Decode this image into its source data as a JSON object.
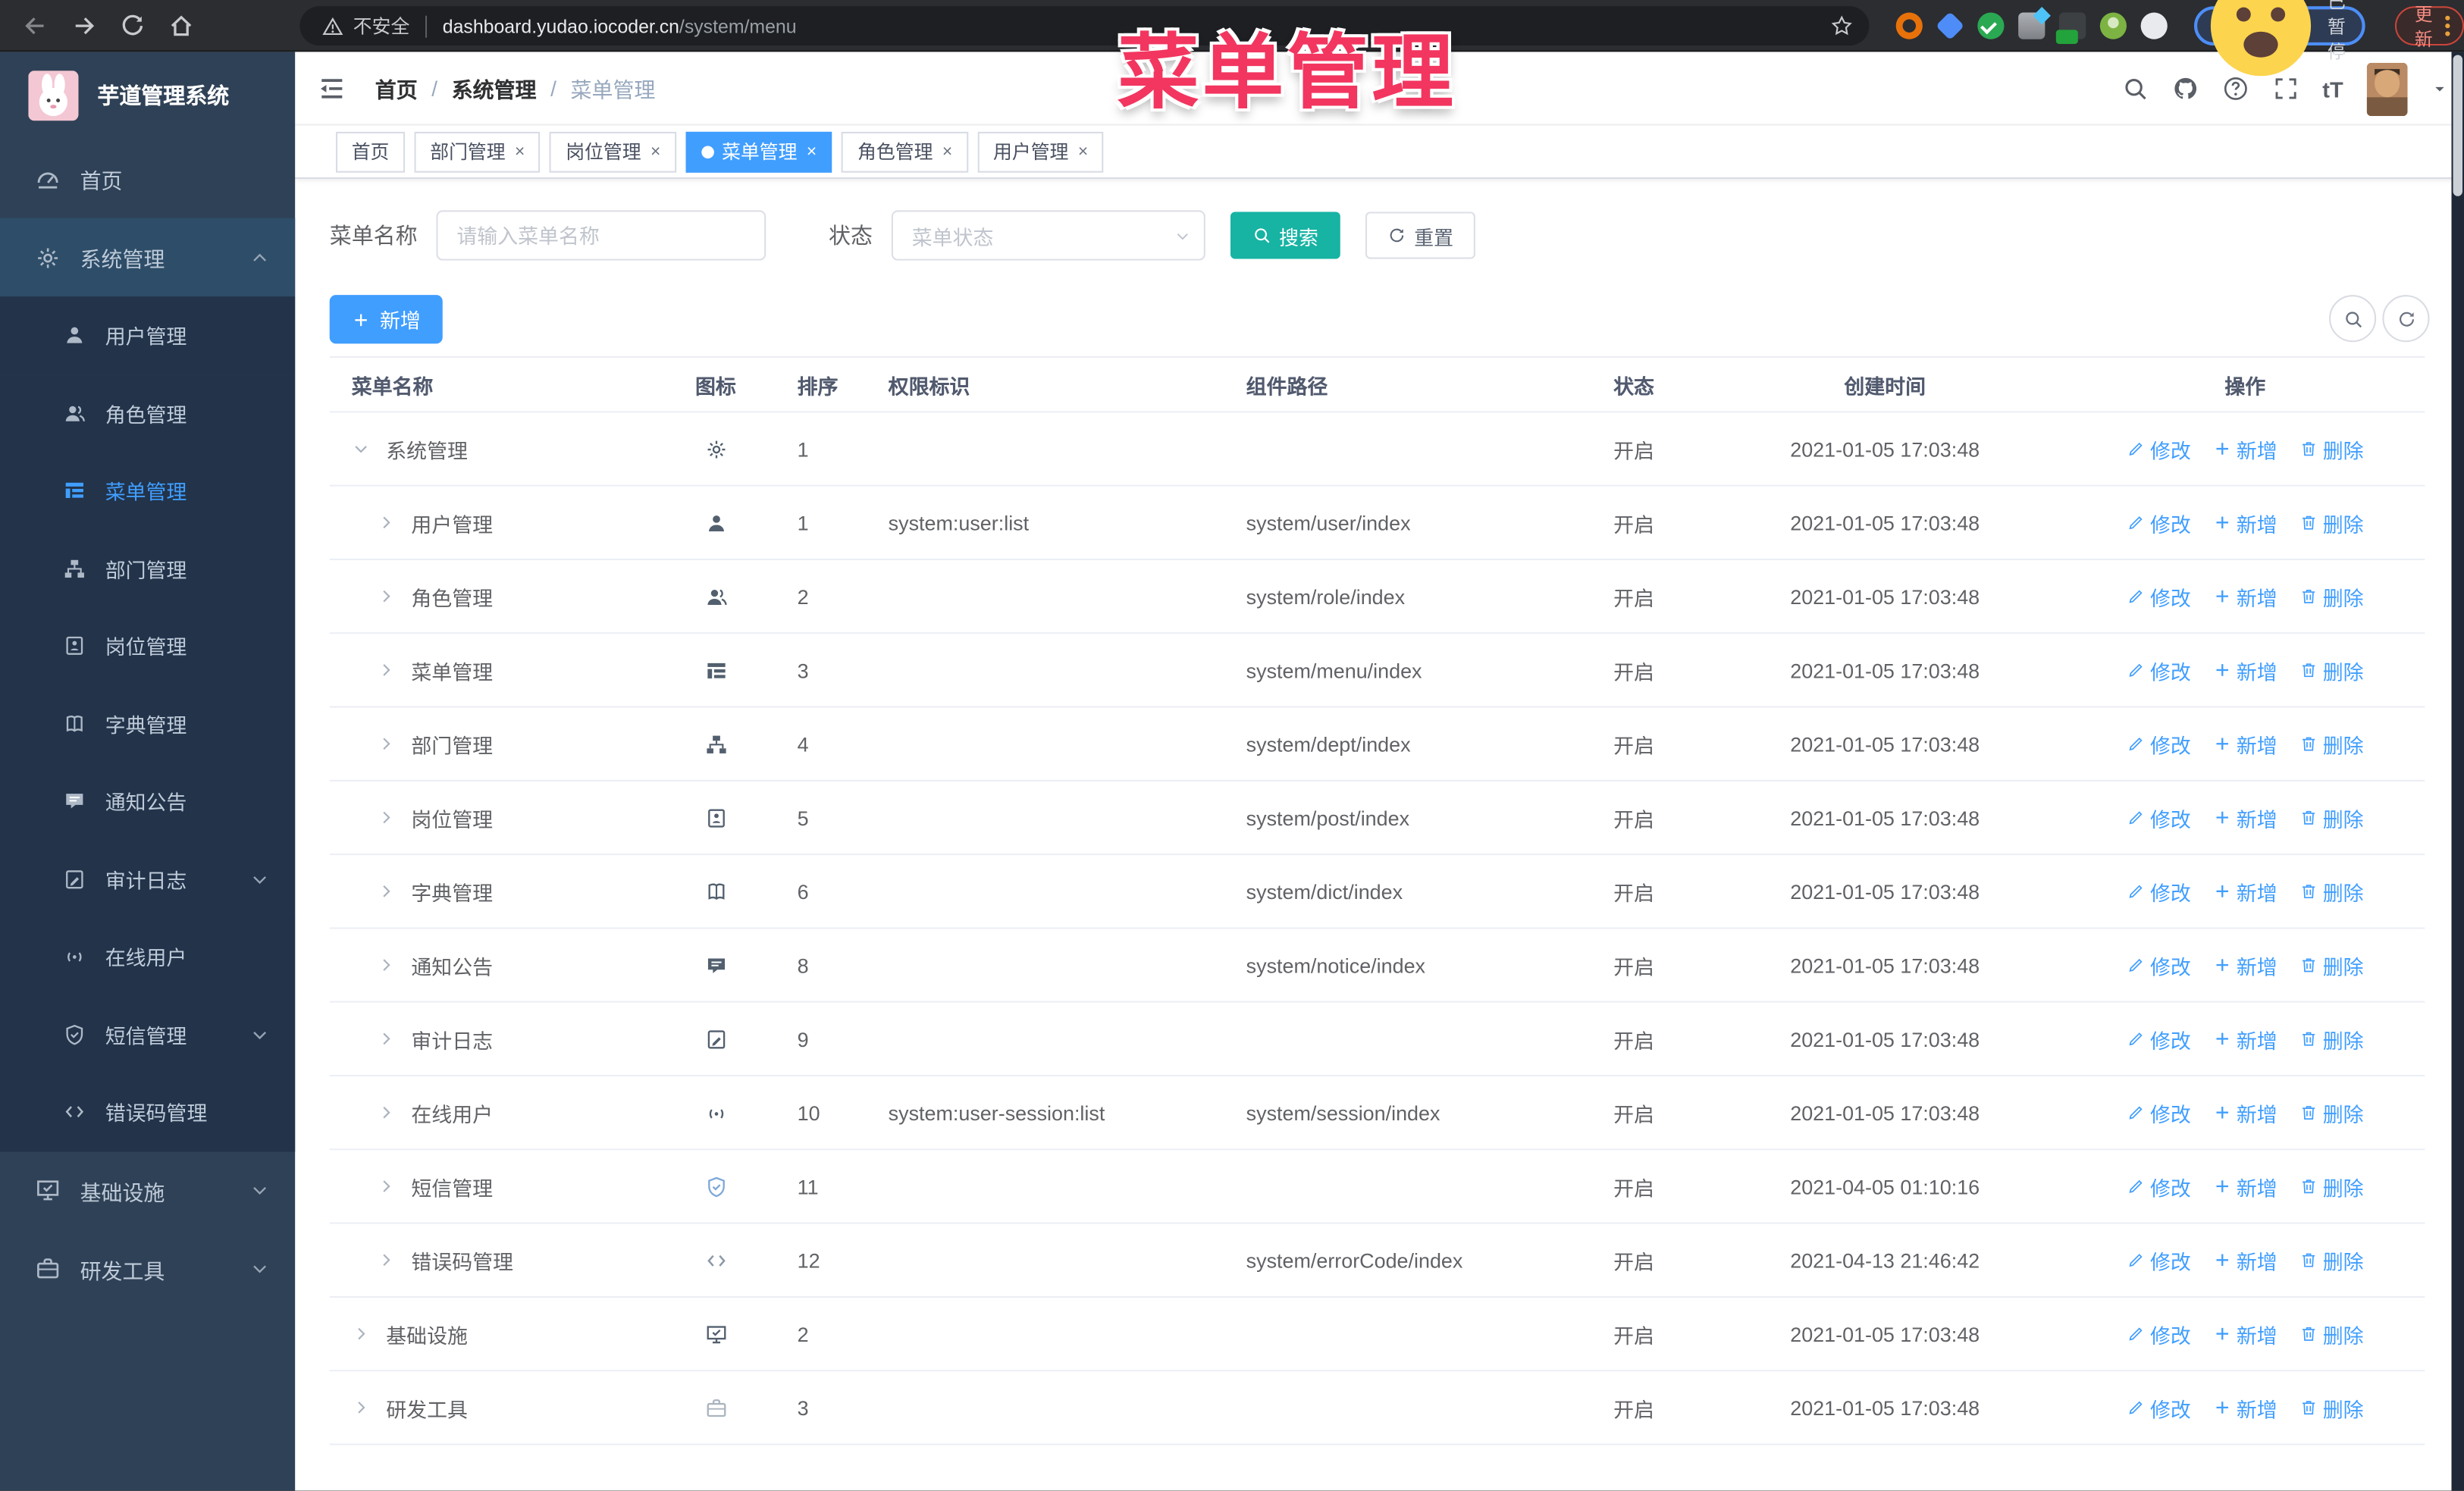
{
  "browser": {
    "security_label": "不安全",
    "url_host": "dashboard.yudao.iocoder.cn",
    "url_path": "/system/menu",
    "nav_icons": [
      "back-icon",
      "forward-icon",
      "reload-icon",
      "home-icon"
    ],
    "extension_icons": [
      "ext-orange-icon",
      "ext-gem-icon",
      "ext-green-check-icon",
      "ext-grid-icon",
      "ext-dark-on-icon",
      "ext-person-icon",
      "ext-puzzle-icon"
    ],
    "profile_badge": "已暂停",
    "update_label": "更新"
  },
  "overlay": {
    "title": "菜单管理"
  },
  "sidebar": {
    "logo_title": "芋道管理系统",
    "menu": [
      {
        "icon": "dashboard",
        "label": "首页",
        "level": 0
      },
      {
        "icon": "gear",
        "label": "系统管理",
        "level": 0,
        "highlight": true,
        "chevron": "up"
      },
      {
        "icon": "user",
        "label": "用户管理",
        "level": 1
      },
      {
        "icon": "users",
        "label": "角色管理",
        "level": 1
      },
      {
        "icon": "tree-table",
        "label": "菜单管理",
        "level": 1,
        "active": true
      },
      {
        "icon": "tree",
        "label": "部门管理",
        "level": 1
      },
      {
        "icon": "post",
        "label": "岗位管理",
        "level": 1
      },
      {
        "icon": "dict",
        "label": "字典管理",
        "level": 1
      },
      {
        "icon": "message",
        "label": "通知公告",
        "level": 1
      },
      {
        "icon": "log",
        "label": "审计日志",
        "level": 1,
        "chevron": "down"
      },
      {
        "icon": "online",
        "label": "在线用户",
        "level": 1
      },
      {
        "icon": "sms",
        "label": "短信管理",
        "level": 1,
        "chevron": "down"
      },
      {
        "icon": "code",
        "label": "错误码管理",
        "level": 1
      },
      {
        "icon": "monitor",
        "label": "基础设施",
        "level": 0,
        "chevron": "down"
      },
      {
        "icon": "tool",
        "label": "研发工具",
        "level": 0,
        "chevron": "down"
      }
    ]
  },
  "header": {
    "breadcrumb": [
      "首页",
      "系统管理",
      "菜单管理"
    ],
    "right_icons": [
      "search-icon",
      "github-icon",
      "help-icon",
      "fullscreen-icon",
      "font-size-icon",
      "avatar",
      "caret-down-icon"
    ],
    "font_size_icon_text": "tT"
  },
  "tabs": [
    {
      "label": "首页",
      "closable": false,
      "active": false
    },
    {
      "label": "部门管理",
      "closable": true,
      "active": false
    },
    {
      "label": "岗位管理",
      "closable": true,
      "active": false
    },
    {
      "label": "菜单管理",
      "closable": true,
      "active": true
    },
    {
      "label": "角色管理",
      "closable": true,
      "active": false
    },
    {
      "label": "用户管理",
      "closable": true,
      "active": false
    }
  ],
  "filters": {
    "name_label": "菜单名称",
    "name_placeholder": "请输入菜单名称",
    "status_label": "状态",
    "status_placeholder": "菜单状态",
    "search_label": "搜索",
    "reset_label": "重置"
  },
  "toolbar": {
    "add_label": "新增"
  },
  "table": {
    "columns": [
      "菜单名称",
      "图标",
      "排序",
      "权限标识",
      "组件路径",
      "状态",
      "创建时间",
      "操作"
    ],
    "row_actions": [
      "修改",
      "新增",
      "删除"
    ],
    "rows": [
      {
        "level": 0,
        "expanded": true,
        "name": "系统管理",
        "icon": "gear",
        "sort": "1",
        "perm": "",
        "path": "",
        "status": "开启",
        "time": "2021-01-05 17:03:48"
      },
      {
        "level": 1,
        "name": "用户管理",
        "icon": "user",
        "sort": "1",
        "perm": "system:user:list",
        "path": "system/user/index",
        "status": "开启",
        "time": "2021-01-05 17:03:48"
      },
      {
        "level": 1,
        "name": "角色管理",
        "icon": "users",
        "sort": "2",
        "perm": "",
        "path": "system/role/index",
        "status": "开启",
        "time": "2021-01-05 17:03:48"
      },
      {
        "level": 1,
        "name": "菜单管理",
        "icon": "tree-table",
        "sort": "3",
        "perm": "",
        "path": "system/menu/index",
        "status": "开启",
        "time": "2021-01-05 17:03:48"
      },
      {
        "level": 1,
        "name": "部门管理",
        "icon": "tree",
        "sort": "4",
        "perm": "",
        "path": "system/dept/index",
        "status": "开启",
        "time": "2021-01-05 17:03:48"
      },
      {
        "level": 1,
        "name": "岗位管理",
        "icon": "post",
        "sort": "5",
        "perm": "",
        "path": "system/post/index",
        "status": "开启",
        "time": "2021-01-05 17:03:48"
      },
      {
        "level": 1,
        "name": "字典管理",
        "icon": "dict",
        "sort": "6",
        "perm": "",
        "path": "system/dict/index",
        "status": "开启",
        "time": "2021-01-05 17:03:48"
      },
      {
        "level": 1,
        "name": "通知公告",
        "icon": "message",
        "sort": "8",
        "perm": "",
        "path": "system/notice/index",
        "status": "开启",
        "time": "2021-01-05 17:03:48"
      },
      {
        "level": 1,
        "name": "审计日志",
        "icon": "log",
        "sort": "9",
        "perm": "",
        "path": "",
        "status": "开启",
        "time": "2021-01-05 17:03:48"
      },
      {
        "level": 1,
        "name": "在线用户",
        "icon": "online",
        "sort": "10",
        "perm": "system:user-session:list",
        "path": "system/session/index",
        "status": "开启",
        "time": "2021-01-05 17:03:48"
      },
      {
        "level": 1,
        "name": "短信管理",
        "icon": "sms",
        "sort": "11",
        "perm": "",
        "path": "",
        "status": "开启",
        "time": "2021-04-05 01:10:16",
        "icon_color": "#7fa8d9"
      },
      {
        "level": 1,
        "name": "错误码管理",
        "icon": "code",
        "sort": "12",
        "perm": "",
        "path": "system/errorCode/index",
        "status": "开启",
        "time": "2021-04-13 21:46:42",
        "icon_color": "#8b98a8"
      },
      {
        "level": 0,
        "name": "基础设施",
        "icon": "monitor",
        "sort": "2",
        "perm": "",
        "path": "",
        "status": "开启",
        "time": "2021-01-05 17:03:48"
      },
      {
        "level": 0,
        "name": "研发工具",
        "icon": "tool",
        "sort": "3",
        "perm": "",
        "path": "",
        "status": "开启",
        "time": "2021-01-05 17:03:48",
        "icon_color": "#aab4bf"
      }
    ]
  },
  "colors": {
    "accent_blue": "#409eff",
    "search_teal": "#17b3a3",
    "overlay_pink": "#f2365f",
    "sidebar_bg": "#2f4156",
    "submenu_bg": "#22334a",
    "status_text": "#606266"
  }
}
